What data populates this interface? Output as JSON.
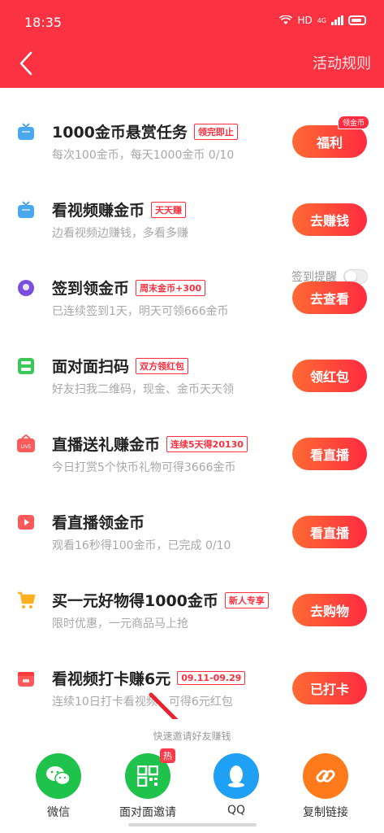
{
  "status": {
    "time": "18:35",
    "network": "HD",
    "signal_label": "4G"
  },
  "header": {
    "rules_label": "活动规则"
  },
  "tasks": [
    {
      "title": "1000金币悬赏任务",
      "tag": "领完即止",
      "desc": "每次100金币，每天1000金币 0/10",
      "button": "福利",
      "badge": "领金币",
      "icon": "tv-icon",
      "icon_color": "#4aa8f0"
    },
    {
      "title": "看视频赚金币",
      "tag": "天天赚",
      "desc": "边看视频边赚钱，多看多赚",
      "button": "去赚钱",
      "icon": "tv-icon",
      "icon_color": "#4aa8f0"
    },
    {
      "title": "签到领金币",
      "tag": "周末金币+300",
      "desc": "已连续签到1天，明天可领666金币",
      "button": "去查看",
      "icon": "location-pin-icon",
      "icon_color": "#7a4fe0"
    },
    {
      "title": "面对面扫码",
      "tag": "双方领红包",
      "desc": "好友扫我二维码，现金、金币天天领",
      "button": "领红包",
      "icon": "scan-icon",
      "icon_color": "#3cc95a"
    },
    {
      "title": "直播送礼赚金币",
      "tag": "连续5天得20130",
      "desc": "今日打赏5个快币礼物可得3666金币",
      "button": "看直播",
      "icon": "live-gift-icon",
      "icon_color": "#ff5a5a"
    },
    {
      "title": "看直播领金币",
      "tag": "",
      "desc": "观看16秒得100金币，已完成 0/10",
      "button": "看直播",
      "icon": "play-icon",
      "icon_color": "#ff5a5a"
    },
    {
      "title": "买一元好物得1000金币",
      "tag": "新人专享",
      "desc": "限时优惠，一元商品马上抢",
      "button": "去购物",
      "icon": "cart-icon",
      "icon_color": "#ffb020"
    },
    {
      "title": "看视频打卡赚6元",
      "tag": "09.11-09.29",
      "desc": "连续10日打卡看视频，可得6元红包",
      "button": "已打卡",
      "icon": "calendar-icon",
      "icon_color": "#ff5a5a"
    }
  ],
  "remind": {
    "label": "签到提醒",
    "enabled": false
  },
  "share": {
    "title": "快速邀请好友赚钱",
    "items": [
      {
        "label": "微信",
        "color": "#1fc24a",
        "icon": "wechat-icon"
      },
      {
        "label": "面对面邀请",
        "color": "#1fc24a",
        "icon": "qr-code-icon",
        "badge": "热"
      },
      {
        "label": "QQ",
        "color": "#1ea0f5",
        "icon": "qq-icon"
      },
      {
        "label": "复制链接",
        "color": "#ff7a1a",
        "icon": "link-icon"
      }
    ]
  },
  "colors": {
    "header_bg": "#fb3241",
    "button_gradient_start": "#ff6a33",
    "button_gradient_end": "#ff2c40",
    "tag_red": "#ff2e3d"
  }
}
